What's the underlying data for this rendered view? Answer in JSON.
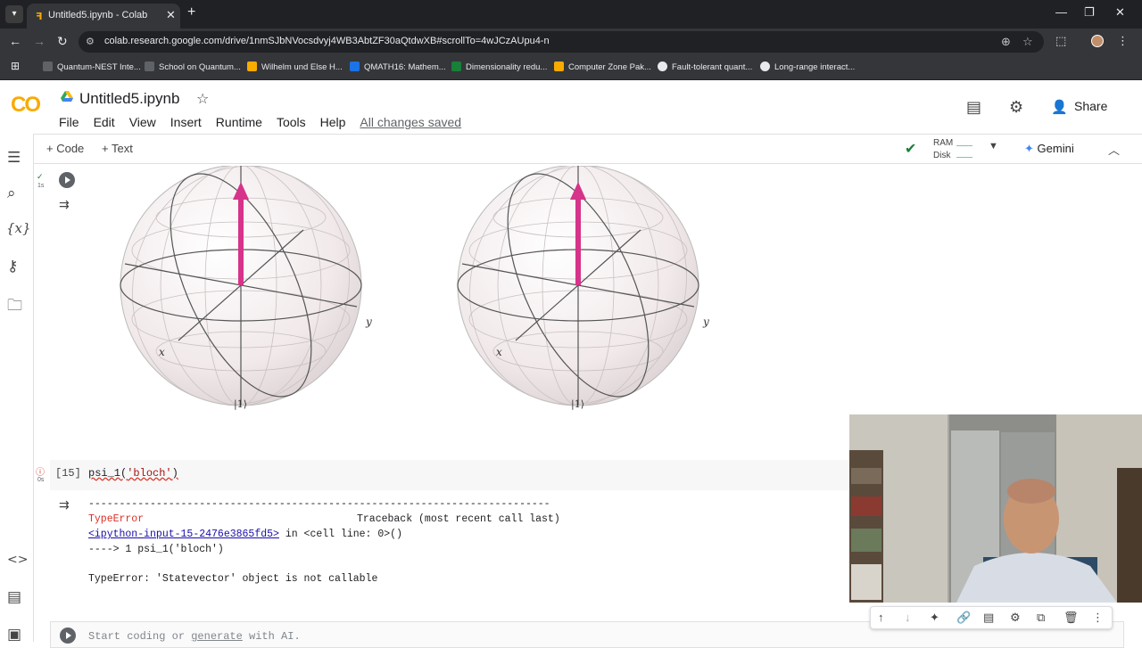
{
  "browser": {
    "tab_title": "Untitled5.ipynb - Colab",
    "url": "colab.research.google.com/drive/1nmSJbNVocsdvyj4WB3AbtZF30aQtdwXB#scrollTo=4wJCzAUpu4-n",
    "bookmarks": [
      {
        "label": "Quantum-NEST Inte...",
        "color": "#5f6368"
      },
      {
        "label": "School on Quantum...",
        "color": "#5f6368"
      },
      {
        "label": "Wilhelm und Else H...",
        "color": "#f9ab00"
      },
      {
        "label": "QMATH16: Mathem...",
        "color": "#1a73e8"
      },
      {
        "label": "Dimensionality redu...",
        "color": "#188038"
      },
      {
        "label": "Computer Zone Pak...",
        "color": "#f9ab00"
      },
      {
        "label": "Fault-tolerant quant...",
        "color": "#e8eaed"
      },
      {
        "label": "Long-range interact...",
        "color": "#e8eaed"
      }
    ]
  },
  "header": {
    "notebook_title": "Untitled5.ipynb",
    "menu": [
      "File",
      "Edit",
      "View",
      "Insert",
      "Runtime",
      "Tools",
      "Help"
    ],
    "saved_status": "All changes saved",
    "share_label": "Share"
  },
  "toolbar": {
    "add_code": "+ Code",
    "add_text": "+ Text",
    "ram_label": "RAM",
    "disk_label": "Disk",
    "gemini_label": "Gemini"
  },
  "cells": {
    "output_cell": {
      "status_time": "1s",
      "bloch_spheres": [
        {
          "x_label": "x",
          "y_label": "y",
          "ket_label": "|1⟩"
        },
        {
          "x_label": "x",
          "y_label": "y",
          "ket_label": "|1⟩"
        }
      ],
      "arrow_color": "#d6338a"
    },
    "error_cell": {
      "status_time": "0s",
      "execution_count": "[15]",
      "code_prefix": "psi_1(",
      "code_string": "'bloch'",
      "code_suffix": ")",
      "divider": "---------------------------------------------------------------------------",
      "error_type": "TypeError",
      "traceback_header": "Traceback (most recent call last)",
      "input_link": "<ipython-input-15-2476e3865fd5>",
      "in_text": " in ",
      "cell_line": "<cell line: 0>()",
      "arrow_line": "----> 1 psi_1('bloch')",
      "error_message": "TypeError: 'Statevector' object is not callable"
    },
    "new_cell": {
      "placeholder_start": "Start coding or ",
      "placeholder_link": "generate",
      "placeholder_end": " with AI."
    }
  }
}
